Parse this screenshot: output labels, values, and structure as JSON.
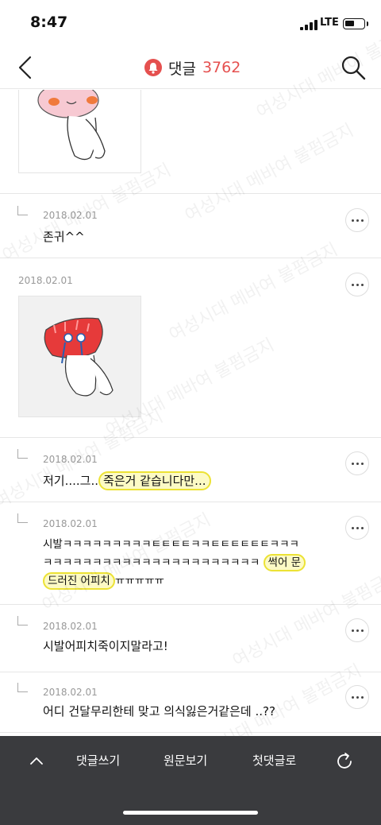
{
  "status_bar": {
    "time": "8:47",
    "network": "LTE"
  },
  "header": {
    "title": "댓글",
    "count": "3762"
  },
  "comments": [
    {
      "date": "2018.02.01",
      "text": "존귀^^"
    },
    {
      "date": "2018.02.01"
    },
    {
      "date": "2018.02.01",
      "text_before": "저기....그..",
      "text_highlight": "죽은거 같습니다만..."
    },
    {
      "date": "2018.02.01",
      "line1": "시발ㅋㅋㅋㅋㅋㅋㅋㅋㅋㅌㅌㅌㅌㅋㅋㅌㅌㅌㅌㅌㅌㅋㅋㅋ",
      "line2_before": "ㅋㅋㅋㅋㅋㅋㅋㅋㅋㅋㅋㅋㅋㅋㅋㅋㅋㅋㅋㅋㅋㅋ",
      "line2_highlight": "썩어 문",
      "line3_highlight": "드러진 어피치",
      "line3_after": "ㅠㅠㅠㅠㅠ"
    },
    {
      "date": "2018.02.01",
      "text": "시발어피치죽이지말라고!"
    },
    {
      "date": "2018.02.01",
      "text": "어디 건달무리한테 맞고 의식잃은거같은데 ..??"
    }
  ],
  "watermark": "여성시대 메바여 불펌금지",
  "bottom_bar": {
    "write": "댓글쓰기",
    "original": "원문보기",
    "first": "첫댓글로"
  },
  "colors": {
    "accent": "#e5504f",
    "highlight": "#ece235",
    "bottom_bar": "#3a3b3e"
  }
}
